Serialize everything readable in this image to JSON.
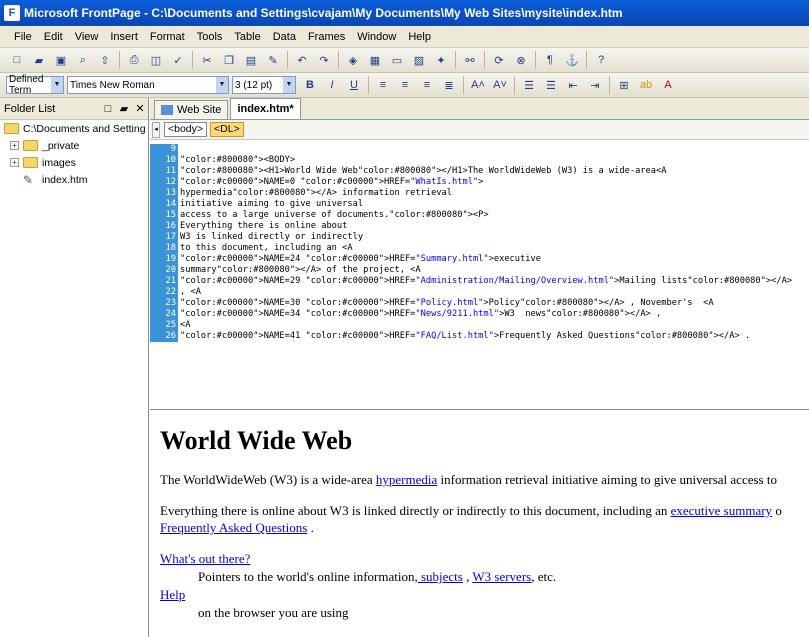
{
  "window": {
    "title": "Microsoft FrontPage - C:\\Documents and Settings\\cvajam\\My Documents\\My Web Sites\\mysite\\index.htm"
  },
  "menu": [
    "File",
    "Edit",
    "View",
    "Insert",
    "Format",
    "Tools",
    "Table",
    "Data",
    "Frames",
    "Window",
    "Help"
  ],
  "format_toolbar": {
    "style": "Defined Term",
    "font": "Times New Roman",
    "size": "3 (12 pt)",
    "bold": "B",
    "italic": "I",
    "underline": "U"
  },
  "folder_list": {
    "title": "Folder List",
    "items": [
      {
        "label": "C:\\Documents and Setting"
      },
      {
        "label": "_private"
      },
      {
        "label": "images"
      },
      {
        "label": "index.htm"
      }
    ]
  },
  "tabs": [
    "Web Site",
    "index.htm*"
  ],
  "tag_selector": [
    "<body>",
    "<DL>"
  ],
  "code_lines": [
    {
      "n": "9",
      "t": ""
    },
    {
      "n": "10",
      "t": "<BODY>"
    },
    {
      "n": "11",
      "t": "<H1>World Wide Web</H1>The WorldWideWeb (W3) is a wide-area<A"
    },
    {
      "n": "12",
      "t": "NAME=0 HREF=\"WhatIs.html\">"
    },
    {
      "n": "13",
      "t": "hypermedia</A> information retrieval"
    },
    {
      "n": "14",
      "t": "initiative aiming to give universal"
    },
    {
      "n": "15",
      "t": "access to a large universe of documents.<P>"
    },
    {
      "n": "16",
      "t": "Everything there is online about"
    },
    {
      "n": "17",
      "t": "W3 is linked directly or indirectly"
    },
    {
      "n": "18",
      "t": "to this document, including an <A"
    },
    {
      "n": "19",
      "t": "NAME=24 HREF=\"Summary.html\">executive"
    },
    {
      "n": "20",
      "t": "summary</A> of the project, <A"
    },
    {
      "n": "21",
      "t": "NAME=29 HREF=\"Administration/Mailing/Overview.html\">Mailing lists</A>"
    },
    {
      "n": "22",
      "t": ", <A"
    },
    {
      "n": "23",
      "t": "NAME=30 HREF=\"Policy.html\">Policy</A> , November's  <A"
    },
    {
      "n": "24",
      "t": "NAME=34 HREF=\"News/9211.html\">W3  news</A> ,"
    },
    {
      "n": "25",
      "t": "<A"
    },
    {
      "n": "26",
      "t": "NAME=41 HREF=\"FAQ/List.html\">Frequently Asked Questions</A> ."
    }
  ],
  "design": {
    "heading": "World Wide Web",
    "p1_a": "The WorldWideWeb (W3) is a wide-area ",
    "p1_link": "hypermedia",
    "p1_b": " information retrieval initiative aiming to give universal access to",
    "p2_a": "Everything there is online about W3 is linked directly or indirectly to this document, including an ",
    "p2_link": "executive summary",
    "p2_b": " o",
    "p2_link2": "Frequently Asked Questions",
    "p2_c": " .",
    "dt1": "What's out there?",
    "dd1_a": "Pointers to the world's online information,",
    "dd1_link1": " subjects",
    "dd1_b": " , ",
    "dd1_link2": "W3 servers",
    "dd1_c": ", etc.",
    "dt2": "Help",
    "dd2": "on the browser you are using"
  }
}
